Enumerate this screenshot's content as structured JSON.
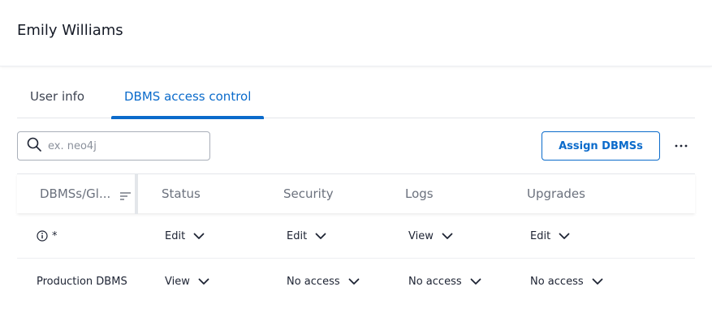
{
  "header": {
    "title": "Emily Williams"
  },
  "tabs": [
    {
      "label": "User info",
      "active": false
    },
    {
      "label": "DBMS access control",
      "active": true
    }
  ],
  "toolbar": {
    "search_placeholder": "ex. neo4j",
    "assign_label": "Assign DBMSs",
    "more_icon": "more-horizontal-icon"
  },
  "table": {
    "columns": [
      "DBMSs/Gl...",
      "Status",
      "Security",
      "Logs",
      "Upgrades"
    ],
    "rows": [
      {
        "name": "*",
        "icon": "info-icon",
        "status": "Edit",
        "security": "Edit",
        "logs": "View",
        "upgrades": "Edit"
      },
      {
        "name": "Production DBMS",
        "status": "View",
        "security": "No access",
        "logs": "No access",
        "upgrades": "No access"
      }
    ]
  },
  "colors": {
    "accent": "#0b6bcb",
    "text": "#1d2333",
    "muted": "#6b717d",
    "border": "#e3e6ea"
  }
}
